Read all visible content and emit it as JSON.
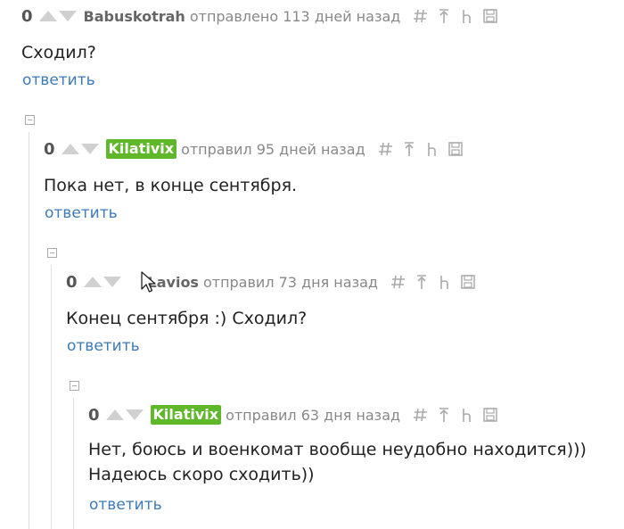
{
  "comments": [
    {
      "score": "0",
      "author": "Babuskotrah",
      "meta": "отправлено 113 дней назад",
      "text": "Сходил?",
      "reply": "ответить"
    },
    {
      "score": "0",
      "author": "Kilativix",
      "meta": "отправил 95 дней назад",
      "text": "Пока нет, в конце сентября.",
      "reply": "ответить"
    },
    {
      "score": "0",
      "author": "Lavios",
      "meta": "отправил 73 дня назад",
      "text": "Конец сентября :) Сходил?",
      "reply": "ответить"
    },
    {
      "score": "0",
      "author": "Kilativix",
      "meta": "отправил 63 дня назад",
      "text_lines": [
        "Нет, боюсь и военкомат вообще неудобно находится)))",
        "Надеюсь скоро сходить))"
      ],
      "reply": "ответить"
    }
  ],
  "colors": {
    "badge": "#5fb82a",
    "link": "#3d7ab8",
    "meta": "#888888",
    "arrow": "#d0d0d0"
  },
  "icons": [
    "hash-icon",
    "jump-to-parent-icon",
    "branch-icon",
    "save-icon"
  ]
}
